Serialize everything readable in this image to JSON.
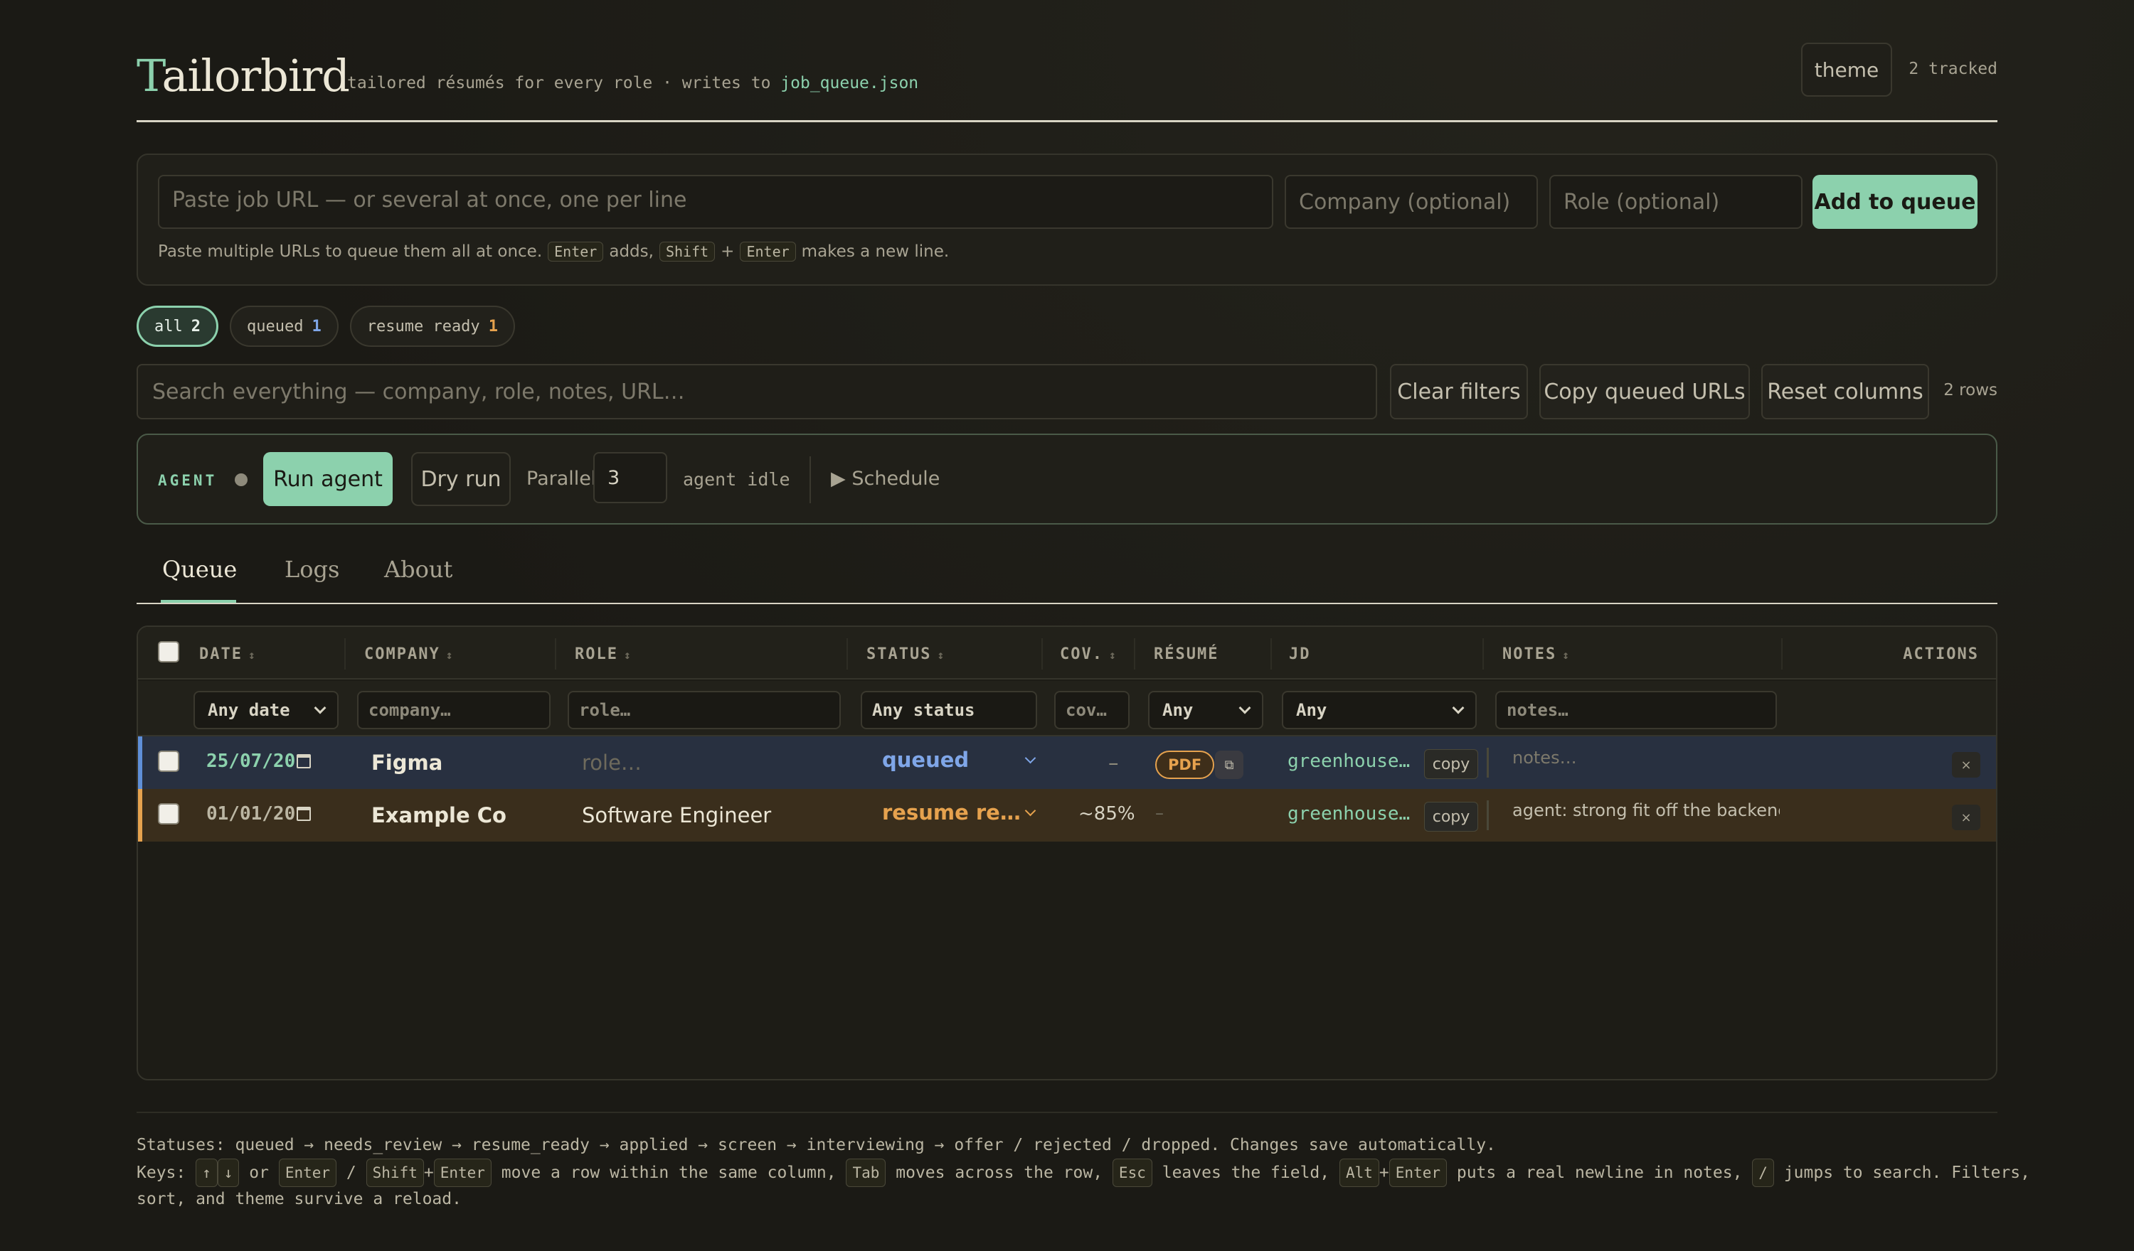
{
  "header": {
    "logo_first": "T",
    "logo_rest": "ailorbird",
    "tagline_prefix": "tailored résumés for every role · writes to ",
    "tagline_file": "job_queue.json",
    "theme_label": "theme",
    "tracked": "2 tracked"
  },
  "intake": {
    "url_placeholder": "Paste job URL — or several at once, one per line",
    "company_placeholder": "Company (optional)",
    "role_placeholder": "Role (optional)",
    "add_label": "Add to queue",
    "hint_1": "Paste multiple URLs to queue them all at once.",
    "hint_enter": "Enter",
    "hint_2": "adds,",
    "hint_shift": "Shift",
    "hint_plus": "+",
    "hint_enter2": "Enter",
    "hint_3": "makes a new line."
  },
  "status_pills": [
    {
      "label": "all",
      "count": "2",
      "active": true
    },
    {
      "label": "queued",
      "count": "1",
      "active": false
    },
    {
      "label": "resume ready",
      "count": "1",
      "active": false
    }
  ],
  "toolbar": {
    "search_placeholder": "Search everything — company, role, notes, URL…",
    "clear_filters": "Clear filters",
    "copy_queued": "Copy queued URLs",
    "reset_columns": "Reset columns",
    "rows_count": "2 rows"
  },
  "agent": {
    "label": "AGENT",
    "run_label": "Run agent",
    "dry_run_label": "Dry run",
    "parallel_label": "Parallel",
    "parallel_value": "3",
    "status": "agent idle",
    "schedule_label": "▶ Schedule"
  },
  "tabs": [
    {
      "label": "Queue",
      "active": true
    },
    {
      "label": "Logs",
      "active": false
    },
    {
      "label": "About",
      "active": false
    }
  ],
  "table": {
    "columns": {
      "date": "DATE",
      "company": "COMPANY",
      "role": "ROLE",
      "status": "STATUS",
      "coverage": "COV.",
      "resume": "RÉSUMÉ",
      "jd": "JD",
      "notes": "NOTES",
      "actions": "ACTIONS"
    },
    "sort_glyph": "↕",
    "filters": {
      "date": "Any date",
      "company": "company…",
      "role": "role…",
      "status": "Any status",
      "coverage": "cov…",
      "resume": "Any",
      "jd": "Any",
      "notes": "notes…"
    },
    "rows": [
      {
        "date": "25/07/20",
        "company": "Figma",
        "role": "role…",
        "status": "queued",
        "coverage": "–",
        "resume": "PDF",
        "resume_copy_icon": "⧉",
        "jd": "greenhouse…",
        "jd_copy": "copy",
        "notes": "notes…",
        "delete": "×"
      },
      {
        "date": "01/01/20",
        "company": "Example Co",
        "role": "Software Engineer",
        "status": "resume re…",
        "coverage": "~85%",
        "resume": "–",
        "jd": "greenhouse…",
        "jd_copy": "copy",
        "notes": "agent: strong fit off the backenc",
        "delete": "×"
      }
    ]
  },
  "footer": {
    "statuses": "Statuses: queued → needs_review → resume_ready → applied → screen → interviewing → offer / rejected / dropped. Changes save automatically.",
    "keys_prefix": "Keys:",
    "k_up": "↑",
    "k_down": "↓",
    "k_or": "or",
    "k_enter": "Enter",
    "k_slash": "/",
    "k_shift": "Shift",
    "k_plus": "+",
    "k_enter2": "Enter",
    "k_move": "move a row within the same column,",
    "k_tab": "Tab",
    "k_across": "moves across the row,",
    "k_esc": "Esc",
    "k_leaves": "leaves the field,",
    "k_alt": "Alt",
    "k_plus2": "+",
    "k_enter3": "Enter",
    "k_newline": "puts a real newline in notes,",
    "k_search": "/",
    "k_jumps": "jumps to search. Filters,",
    "keys_line2": "sort, and theme survive a reload."
  },
  "colors": {
    "accent": "#8cd1ad",
    "queued": "#7fa6e8",
    "resume_ready": "#e6a24e",
    "background": "#1b1a15"
  }
}
